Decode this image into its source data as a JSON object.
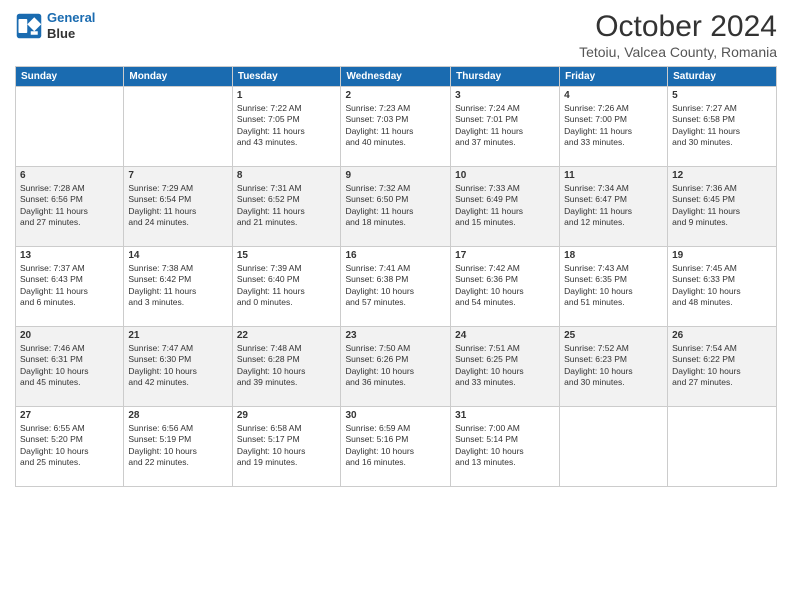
{
  "header": {
    "logo_line1": "General",
    "logo_line2": "Blue",
    "month": "October 2024",
    "location": "Tetoiu, Valcea County, Romania"
  },
  "weekdays": [
    "Sunday",
    "Monday",
    "Tuesday",
    "Wednesday",
    "Thursday",
    "Friday",
    "Saturday"
  ],
  "weeks": [
    [
      {
        "day": "",
        "info": ""
      },
      {
        "day": "",
        "info": ""
      },
      {
        "day": "1",
        "info": "Sunrise: 7:22 AM\nSunset: 7:05 PM\nDaylight: 11 hours\nand 43 minutes."
      },
      {
        "day": "2",
        "info": "Sunrise: 7:23 AM\nSunset: 7:03 PM\nDaylight: 11 hours\nand 40 minutes."
      },
      {
        "day": "3",
        "info": "Sunrise: 7:24 AM\nSunset: 7:01 PM\nDaylight: 11 hours\nand 37 minutes."
      },
      {
        "day": "4",
        "info": "Sunrise: 7:26 AM\nSunset: 7:00 PM\nDaylight: 11 hours\nand 33 minutes."
      },
      {
        "day": "5",
        "info": "Sunrise: 7:27 AM\nSunset: 6:58 PM\nDaylight: 11 hours\nand 30 minutes."
      }
    ],
    [
      {
        "day": "6",
        "info": "Sunrise: 7:28 AM\nSunset: 6:56 PM\nDaylight: 11 hours\nand 27 minutes."
      },
      {
        "day": "7",
        "info": "Sunrise: 7:29 AM\nSunset: 6:54 PM\nDaylight: 11 hours\nand 24 minutes."
      },
      {
        "day": "8",
        "info": "Sunrise: 7:31 AM\nSunset: 6:52 PM\nDaylight: 11 hours\nand 21 minutes."
      },
      {
        "day": "9",
        "info": "Sunrise: 7:32 AM\nSunset: 6:50 PM\nDaylight: 11 hours\nand 18 minutes."
      },
      {
        "day": "10",
        "info": "Sunrise: 7:33 AM\nSunset: 6:49 PM\nDaylight: 11 hours\nand 15 minutes."
      },
      {
        "day": "11",
        "info": "Sunrise: 7:34 AM\nSunset: 6:47 PM\nDaylight: 11 hours\nand 12 minutes."
      },
      {
        "day": "12",
        "info": "Sunrise: 7:36 AM\nSunset: 6:45 PM\nDaylight: 11 hours\nand 9 minutes."
      }
    ],
    [
      {
        "day": "13",
        "info": "Sunrise: 7:37 AM\nSunset: 6:43 PM\nDaylight: 11 hours\nand 6 minutes."
      },
      {
        "day": "14",
        "info": "Sunrise: 7:38 AM\nSunset: 6:42 PM\nDaylight: 11 hours\nand 3 minutes."
      },
      {
        "day": "15",
        "info": "Sunrise: 7:39 AM\nSunset: 6:40 PM\nDaylight: 11 hours\nand 0 minutes."
      },
      {
        "day": "16",
        "info": "Sunrise: 7:41 AM\nSunset: 6:38 PM\nDaylight: 10 hours\nand 57 minutes."
      },
      {
        "day": "17",
        "info": "Sunrise: 7:42 AM\nSunset: 6:36 PM\nDaylight: 10 hours\nand 54 minutes."
      },
      {
        "day": "18",
        "info": "Sunrise: 7:43 AM\nSunset: 6:35 PM\nDaylight: 10 hours\nand 51 minutes."
      },
      {
        "day": "19",
        "info": "Sunrise: 7:45 AM\nSunset: 6:33 PM\nDaylight: 10 hours\nand 48 minutes."
      }
    ],
    [
      {
        "day": "20",
        "info": "Sunrise: 7:46 AM\nSunset: 6:31 PM\nDaylight: 10 hours\nand 45 minutes."
      },
      {
        "day": "21",
        "info": "Sunrise: 7:47 AM\nSunset: 6:30 PM\nDaylight: 10 hours\nand 42 minutes."
      },
      {
        "day": "22",
        "info": "Sunrise: 7:48 AM\nSunset: 6:28 PM\nDaylight: 10 hours\nand 39 minutes."
      },
      {
        "day": "23",
        "info": "Sunrise: 7:50 AM\nSunset: 6:26 PM\nDaylight: 10 hours\nand 36 minutes."
      },
      {
        "day": "24",
        "info": "Sunrise: 7:51 AM\nSunset: 6:25 PM\nDaylight: 10 hours\nand 33 minutes."
      },
      {
        "day": "25",
        "info": "Sunrise: 7:52 AM\nSunset: 6:23 PM\nDaylight: 10 hours\nand 30 minutes."
      },
      {
        "day": "26",
        "info": "Sunrise: 7:54 AM\nSunset: 6:22 PM\nDaylight: 10 hours\nand 27 minutes."
      }
    ],
    [
      {
        "day": "27",
        "info": "Sunrise: 6:55 AM\nSunset: 5:20 PM\nDaylight: 10 hours\nand 25 minutes."
      },
      {
        "day": "28",
        "info": "Sunrise: 6:56 AM\nSunset: 5:19 PM\nDaylight: 10 hours\nand 22 minutes."
      },
      {
        "day": "29",
        "info": "Sunrise: 6:58 AM\nSunset: 5:17 PM\nDaylight: 10 hours\nand 19 minutes."
      },
      {
        "day": "30",
        "info": "Sunrise: 6:59 AM\nSunset: 5:16 PM\nDaylight: 10 hours\nand 16 minutes."
      },
      {
        "day": "31",
        "info": "Sunrise: 7:00 AM\nSunset: 5:14 PM\nDaylight: 10 hours\nand 13 minutes."
      },
      {
        "day": "",
        "info": ""
      },
      {
        "day": "",
        "info": ""
      }
    ]
  ]
}
